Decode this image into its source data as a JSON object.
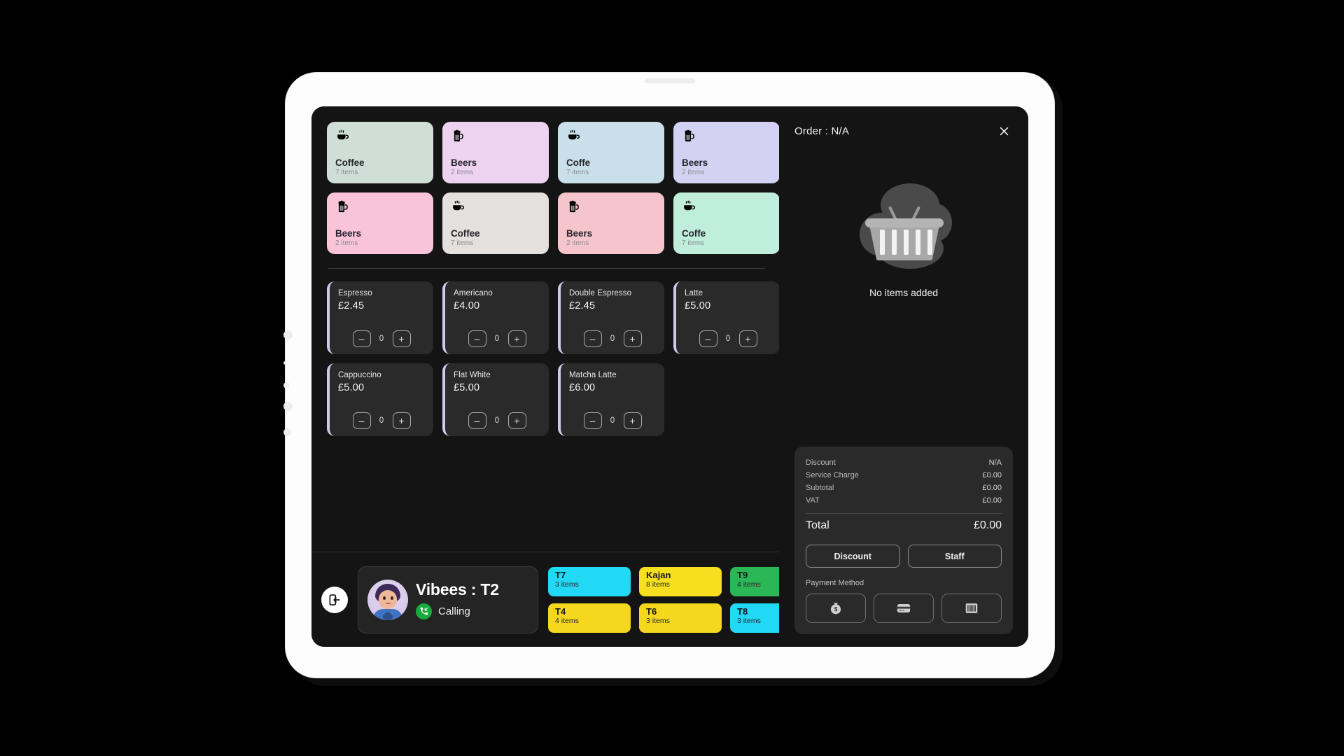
{
  "device": {
    "kind": "tablet"
  },
  "catalog": {
    "categories": [
      {
        "name": "Coffee",
        "count": "7 items",
        "icon": "coffee-cup-icon",
        "color": "#cfded6"
      },
      {
        "name": "Beers",
        "count": "2 items",
        "icon": "beer-mug-icon",
        "color": "#eed3f0"
      },
      {
        "name": "Coffe",
        "count": "7 items",
        "icon": "coffee-cup-icon",
        "color": "#c9e0ea"
      },
      {
        "name": "Beers",
        "count": "2 items",
        "icon": "beer-mug-icon",
        "color": "#d4d2f2"
      },
      {
        "name": "Beers",
        "count": "2 items",
        "icon": "beer-mug-icon",
        "color": "#f9c3d8"
      },
      {
        "name": "Coffee",
        "count": "7 items",
        "icon": "coffee-cup-icon",
        "color": "#e4e0dd"
      },
      {
        "name": "Beers",
        "count": "2 items",
        "icon": "beer-mug-icon",
        "color": "#f6c5cc"
      },
      {
        "name": "Coffe",
        "count": "7 items",
        "icon": "coffee-cup-icon",
        "color": "#bfeedc"
      }
    ],
    "products": [
      {
        "name": "Espresso",
        "price": "£2.45",
        "qty": "0"
      },
      {
        "name": "Americano",
        "price": "£4.00",
        "qty": "0"
      },
      {
        "name": "Double Espresso",
        "price": "£2.45",
        "qty": "0"
      },
      {
        "name": "Latte",
        "price": "£5.00",
        "qty": "0"
      },
      {
        "name": "Cappuccino",
        "price": "£5.00",
        "qty": "0"
      },
      {
        "name": "Flat White",
        "price": "£5.00",
        "qty": "0"
      },
      {
        "name": "Matcha Latte",
        "price": "£6.00",
        "qty": "0"
      }
    ],
    "stepper": {
      "minus": "–",
      "plus": "+"
    },
    "accent_color": "#cdcbeb"
  },
  "bottom_bar": {
    "exit_icon": "exit-door-icon",
    "caller": {
      "title": "Vibees : T2",
      "status": "Calling",
      "status_icon": "incoming-call-icon",
      "status_color": "#17ab3e",
      "avatar": "user-avatar"
    },
    "tables": [
      {
        "name": "T7",
        "items": "3 items",
        "color": "#21d9f5"
      },
      {
        "name": "Kajan",
        "items": "8 items",
        "color": "#f5df1e"
      },
      {
        "name": "T9",
        "items": "4 items",
        "color": "#2cb757"
      },
      {
        "name": "T4",
        "items": "4 items",
        "color": "#f5d81e"
      },
      {
        "name": "T6",
        "items": "3 items",
        "color": "#f5d81e"
      },
      {
        "name": "T8",
        "items": "3 items",
        "color": "#21d9f5"
      }
    ]
  },
  "order": {
    "title": "Order : N/A",
    "close_icon": "close-icon",
    "empty_text": "No items added",
    "empty_icon": "empty-basket-icon",
    "summary": [
      {
        "label": "Discount",
        "value": "N/A"
      },
      {
        "label": "Service Charge",
        "value": "£0.00"
      },
      {
        "label": "Subtotal",
        "value": "£0.00"
      },
      {
        "label": "VAT",
        "value": "£0.00"
      }
    ],
    "total": {
      "label": "Total",
      "value": "£0.00"
    },
    "actions": [
      {
        "label": "Discount"
      },
      {
        "label": "Staff"
      }
    ],
    "payment": {
      "label": "Payment Method",
      "methods": [
        {
          "icon": "cash-bag-icon"
        },
        {
          "icon": "credit-card-icon"
        },
        {
          "icon": "barcode-icon"
        }
      ]
    }
  }
}
